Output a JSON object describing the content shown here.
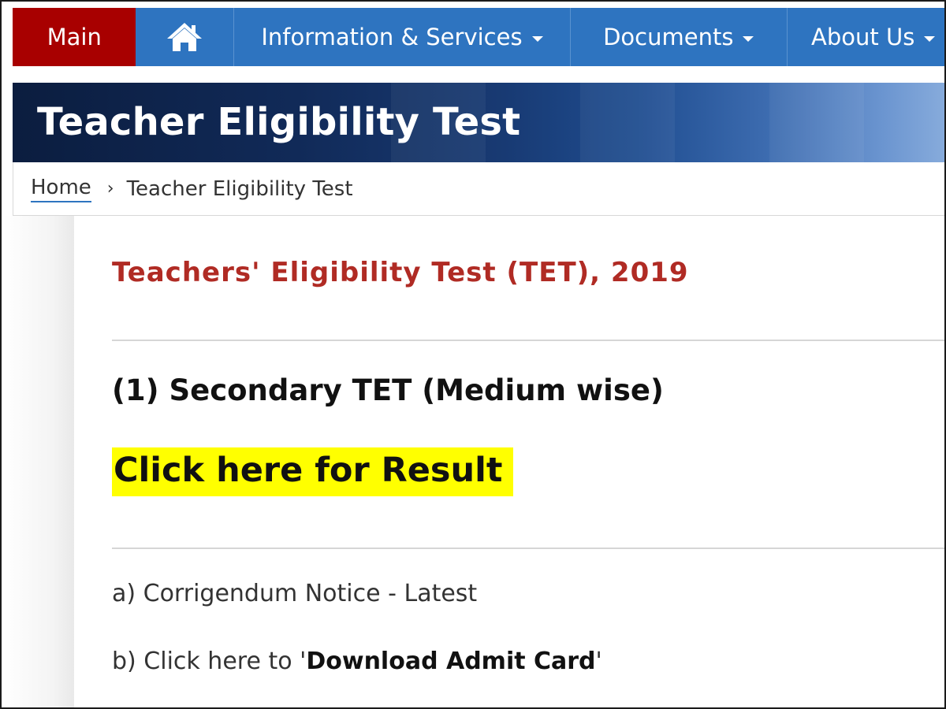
{
  "nav": {
    "main_label": "Main",
    "home_icon": "home-icon",
    "info_label": "Information & Services",
    "documents_label": "Documents",
    "about_label": "About Us"
  },
  "banner": {
    "title": "Teacher Eligibility Test"
  },
  "breadcrumb": {
    "home": "Home",
    "separator": "›",
    "current": "Teacher Eligibility Test"
  },
  "content": {
    "heading": "Teachers' Eligibility Test (TET), 2019",
    "section_heading": "(1) Secondary TET (Medium wise)",
    "result_link": "Click here for Result",
    "corrigendum": "a) Corrigendum Notice - Latest",
    "admit_prefix": "b) Click here to '",
    "admit_link": "Download Admit Card",
    "admit_suffix": "'"
  },
  "colors": {
    "nav_bg": "#2e74c0",
    "main_tab_bg": "#a80000",
    "heading_red": "#b02b24",
    "highlight": "#ffff00"
  }
}
